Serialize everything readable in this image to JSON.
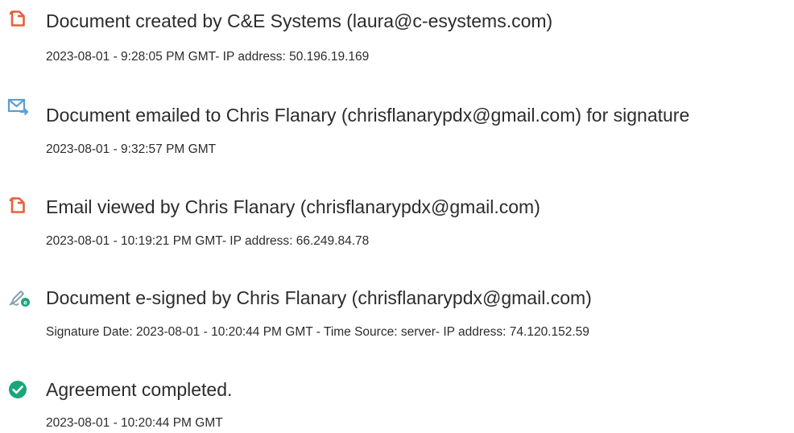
{
  "events": [
    {
      "icon": "document-create-icon",
      "title": "Document created by C&E Systems (laura@c-esystems.com)",
      "detail": "2023-08-01 - 9:28:05 PM GMT- IP address: 50.196.19.169"
    },
    {
      "icon": "email-sent-icon",
      "title": "Document emailed to Chris Flanary (chrisflanarypdx@gmail.com) for signature",
      "detail": "2023-08-01 - 9:32:57 PM GMT"
    },
    {
      "icon": "document-view-icon",
      "title": "Email viewed by Chris Flanary (chrisflanarypdx@gmail.com)",
      "detail": "2023-08-01 - 10:19:21 PM GMT- IP address: 66.249.84.78"
    },
    {
      "icon": "pen-esign-icon",
      "title": "Document e-signed by Chris Flanary (chrisflanarypdx@gmail.com)",
      "detail": "Signature Date: 2023-08-01 - 10:20:44 PM GMT - Time Source: server- IP address: 74.120.152.59"
    },
    {
      "icon": "check-circle-icon",
      "title": "Agreement completed.",
      "detail": "2023-08-01 - 10:20:44 PM GMT"
    }
  ],
  "colors": {
    "document_icon": "#e8603a",
    "email_icon": "#5a9fd4",
    "pen_icon": "#8aa0ad",
    "esign_badge": "#1aa57a",
    "check_icon": "#1aa57a",
    "text": "#2c2c2c"
  }
}
